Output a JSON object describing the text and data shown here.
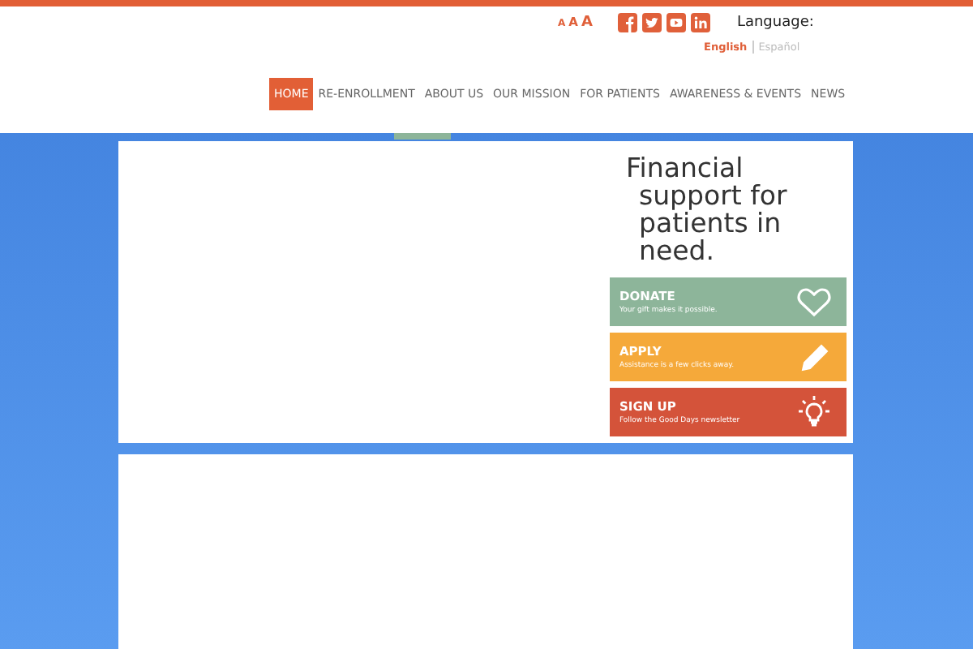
{
  "header": {
    "font_sizes": [
      "A",
      "A",
      "A"
    ],
    "social": [
      {
        "kind": "facebook"
      },
      {
        "kind": "twitter"
      },
      {
        "kind": "youtube"
      },
      {
        "kind": "linkedin"
      }
    ],
    "language_label": "Language:",
    "languages": [
      {
        "label": "English",
        "selected": true
      },
      {
        "label": "Español",
        "selected": false
      }
    ],
    "nav": [
      {
        "label": "HOME",
        "selected": true
      },
      {
        "label": "RE-ENROLLMENT",
        "selected": false
      },
      {
        "label": "ABOUT US",
        "selected": false
      },
      {
        "label": "OUR MISSION",
        "selected": false
      },
      {
        "label": "FOR PATIENTS",
        "selected": false
      },
      {
        "label": "AWARENESS & EVENTS",
        "selected": false
      },
      {
        "label": "NEWS",
        "selected": false
      }
    ]
  },
  "hero": {
    "headline": "Financial support for patients in need.",
    "actions": [
      {
        "title": "DONATE",
        "subtitle": "Your gift makes it possible.",
        "color": "#8db59a",
        "kind": "heart"
      },
      {
        "title": "APPLY",
        "subtitle": "Assistance is a few clicks away.",
        "color": "#f5a93a",
        "kind": "pencil"
      },
      {
        "title": "SIGN UP",
        "subtitle": "Follow the Good Days newsletter",
        "color": "#d4533a",
        "kind": "bulb"
      }
    ]
  }
}
